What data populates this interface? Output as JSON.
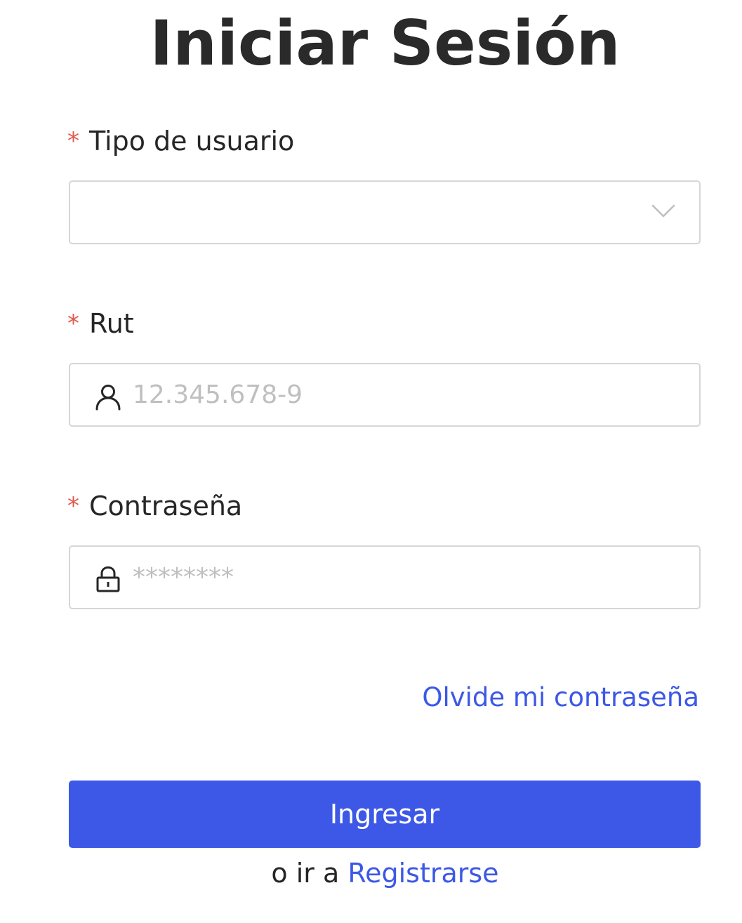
{
  "page_title": "Iniciar Sesión",
  "required_mark": "*",
  "fields": {
    "user_type": {
      "label": "Tipo de usuario",
      "value": "",
      "icon": "chevron-down-icon"
    },
    "rut": {
      "label": "Rut",
      "placeholder": "12.345.678-9",
      "icon": "user-icon"
    },
    "password": {
      "label": "Contraseña",
      "placeholder": "********",
      "icon": "lock-icon"
    }
  },
  "forgot_password_link": "Olvide mi contraseña",
  "submit_button": "Ingresar",
  "register": {
    "prefix": "o ir a",
    "link": "Registrarse"
  },
  "colors": {
    "primary": "#3d58e6",
    "required": "#e05a4e",
    "border": "#d6d6d6",
    "placeholder": "#bfbfbf"
  }
}
